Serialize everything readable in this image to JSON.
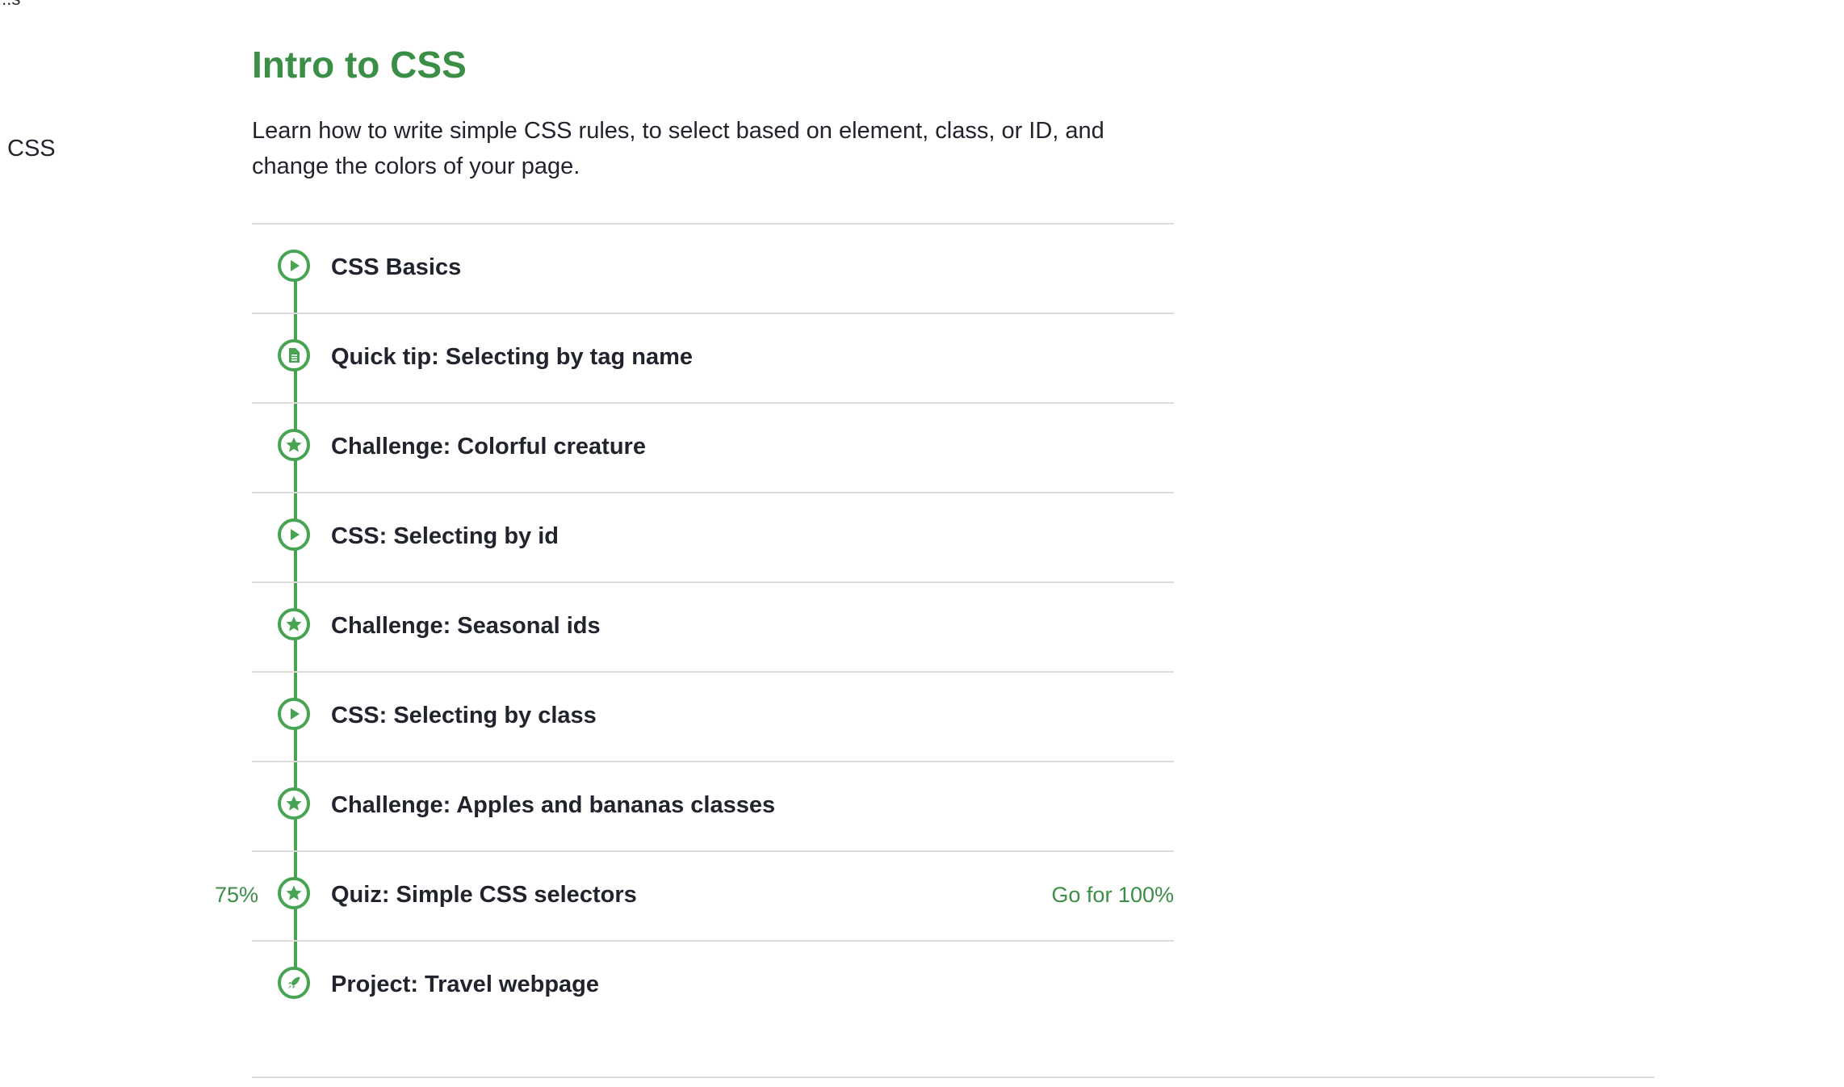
{
  "left_panel": {
    "corner_fragment": "...s",
    "side_label": "CSS"
  },
  "unit": {
    "title": "Intro to CSS",
    "description": "Learn how to write simple CSS rules, to select based on element, class, or ID, and change the colors of your page."
  },
  "lessons": [
    {
      "title": "CSS Basics",
      "icon": "play-icon"
    },
    {
      "title": "Quick tip: Selecting by tag name",
      "icon": "article-icon"
    },
    {
      "title": "Challenge: Colorful creature",
      "icon": "star-icon"
    },
    {
      "title": "CSS: Selecting by id",
      "icon": "play-icon"
    },
    {
      "title": "Challenge: Seasonal ids",
      "icon": "star-icon"
    },
    {
      "title": "CSS: Selecting by class",
      "icon": "play-icon"
    },
    {
      "title": "Challenge: Apples and bananas classes",
      "icon": "star-icon"
    },
    {
      "title": "Quiz: Simple CSS selectors",
      "icon": "star-icon",
      "score": "75%",
      "action": "Go for 100%"
    },
    {
      "title": "Project: Travel webpage",
      "icon": "rocket-icon"
    }
  ],
  "colors": {
    "accent": "#3b8e46",
    "icon_stroke": "#48a452",
    "divider": "#dcdcdc",
    "text": "#21242c"
  }
}
